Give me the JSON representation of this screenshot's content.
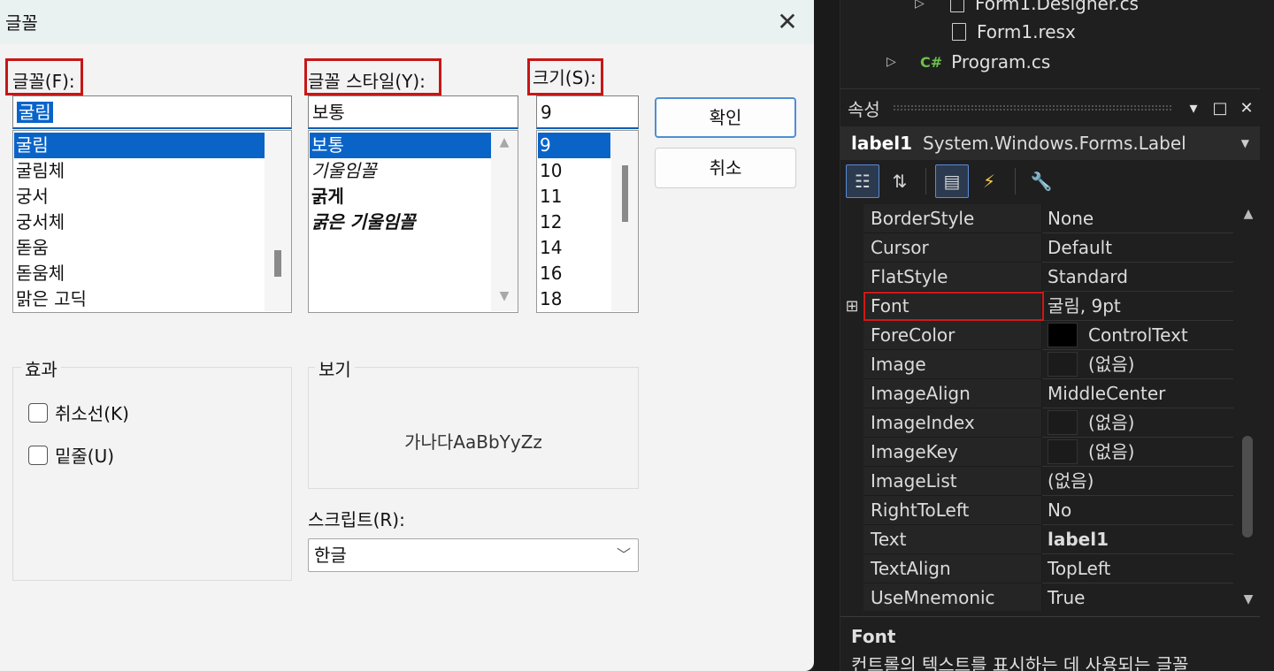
{
  "dialog": {
    "title": "글꼴",
    "font_label": "글꼴(F):",
    "font_input": "굴림",
    "font_list": [
      "굴림",
      "굴림체",
      "궁서",
      "궁서체",
      "돋움",
      "돋움체",
      "맑은 고딕"
    ],
    "font_selected_index": 0,
    "style_label": "글꼴 스타일(Y):",
    "style_input": "보통",
    "style_list": [
      "보통",
      "기울임꼴",
      "굵게",
      "굵은 기울임꼴"
    ],
    "style_selected_index": 0,
    "size_label": "크기(S):",
    "size_input": "9",
    "size_list": [
      "9",
      "10",
      "11",
      "12",
      "14",
      "16",
      "18"
    ],
    "size_selected_index": 0,
    "ok_label": "확인",
    "cancel_label": "취소",
    "effects_label": "효과",
    "strikeout_label": "취소선(K)",
    "underline_label": "밑줄(U)",
    "preview_label": "보기",
    "preview_text": "가나다AaBbYyZz",
    "script_label": "스크립트(R):",
    "script_value": "한글"
  },
  "solution_tree": {
    "items": [
      {
        "name": "Form1.Designer.cs"
      },
      {
        "name": "Form1.resx"
      },
      {
        "name": "Program.cs",
        "prefix": "C#"
      }
    ]
  },
  "properties": {
    "title": "속성",
    "object_name": "label1",
    "object_type": "System.Windows.Forms.Label",
    "rows": [
      {
        "name": "BorderStyle",
        "value": "None"
      },
      {
        "name": "Cursor",
        "value": "Default"
      },
      {
        "name": "FlatStyle",
        "value": "Standard"
      },
      {
        "name": "Font",
        "value": "굴림, 9pt",
        "expandable": true
      },
      {
        "name": "ForeColor",
        "value": "ControlText",
        "swatch": "#000000"
      },
      {
        "name": "Image",
        "value": "(없음)",
        "swatch": "#1b1b1b"
      },
      {
        "name": "ImageAlign",
        "value": "MiddleCenter"
      },
      {
        "name": "ImageIndex",
        "value": "(없음)",
        "swatch": "#1b1b1b"
      },
      {
        "name": "ImageKey",
        "value": "(없음)",
        "swatch": "#1b1b1b"
      },
      {
        "name": "ImageList",
        "value": "(없음)"
      },
      {
        "name": "RightToLeft",
        "value": "No"
      },
      {
        "name": "Text",
        "value": "label1",
        "bold": true
      },
      {
        "name": "TextAlign",
        "value": "TopLeft"
      },
      {
        "name": "UseMnemonic",
        "value": "True"
      }
    ],
    "description_title": "Font",
    "description_text": "컨트롤의 텍스트를 표시하는 데 사용되는 글꼴"
  },
  "colors": {
    "selection": "#0a64c8",
    "highlight_border": "#c81616",
    "vs_background": "#1f1f1f"
  }
}
